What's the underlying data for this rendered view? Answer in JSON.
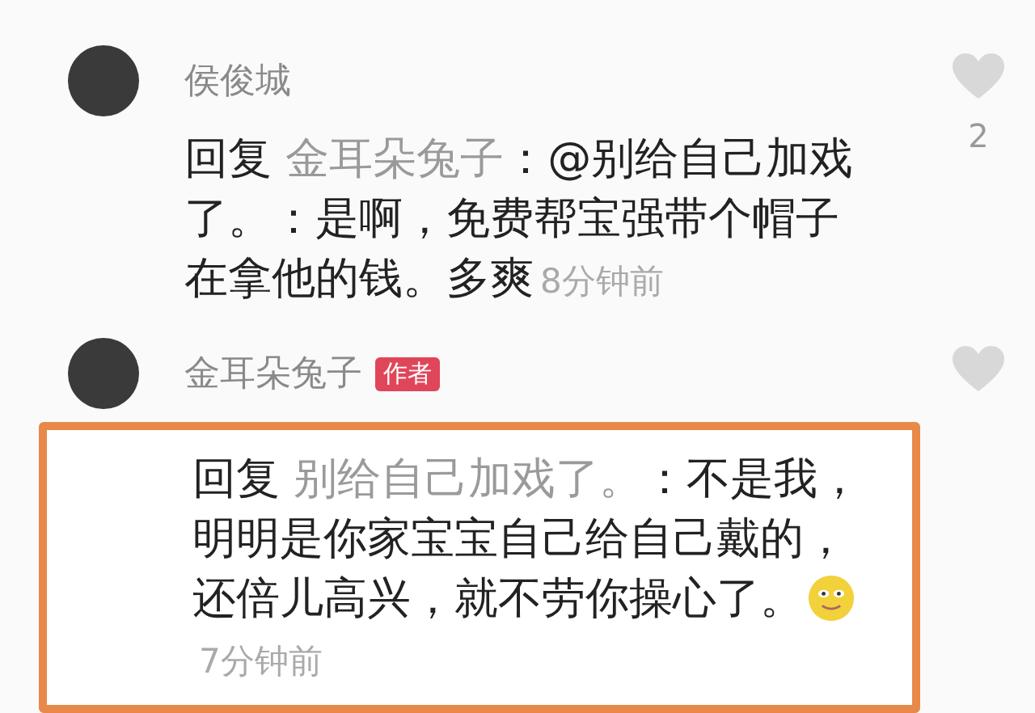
{
  "comments": [
    {
      "author": "侯俊城",
      "reply_label": "回复",
      "reply_to": "金耳朵兔子",
      "body": "：@别给自己加戏了。：是啊，免费帮宝强带个帽子在拿他的钱。多爽",
      "time": "8分钟前",
      "likes": "2"
    },
    {
      "author": "金耳朵兔子",
      "badge": "作者",
      "reply_label": "回复",
      "reply_to": "别给自己加戏了。",
      "body": "：不是我，明明是你家宝宝自己给自己戴的，还倍儿高兴，就不劳你操心了。",
      "time": "7分钟前",
      "emoji": true,
      "highlighted": true
    }
  ]
}
